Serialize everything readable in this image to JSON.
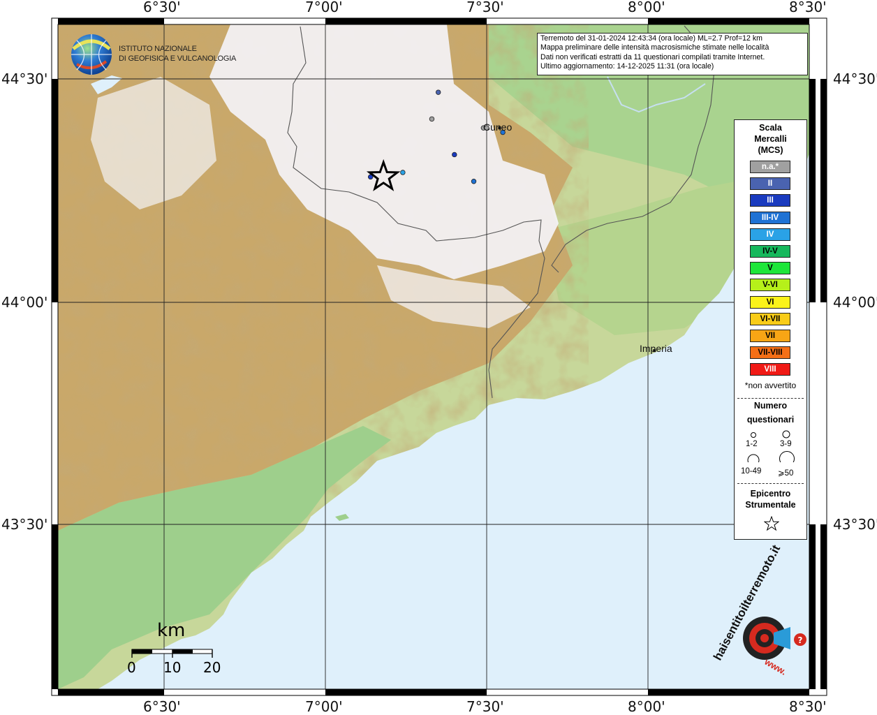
{
  "map": {
    "top_lon_labels": [
      "6°30'",
      "7°00'",
      "7°30'",
      "8°00'",
      "8°30'"
    ],
    "bottom_lon_labels": [
      "6°30'",
      "7°00'",
      "7°30'",
      "8°00'",
      "8°30'"
    ],
    "left_lat_labels": [
      "44°30'",
      "44°00'",
      "43°30'"
    ],
    "right_lat_labels": [
      "44°30'",
      "44°00'",
      "43°30'"
    ],
    "cities": [
      {
        "name": "Cuneo",
        "lon": 7.54,
        "lat": 44.39
      },
      {
        "name": "Imperia",
        "lon": 8.02,
        "lat": 43.89
      }
    ],
    "epicenter": {
      "lon": 7.18,
      "lat": 44.28
    },
    "observations": [
      {
        "lon": 7.35,
        "lat": 44.47,
        "intensity": "II"
      },
      {
        "lon": 7.33,
        "lat": 44.41,
        "intensity": "n.a.*"
      },
      {
        "lon": 7.4,
        "lat": 44.33,
        "intensity": "III"
      },
      {
        "lon": 7.14,
        "lat": 44.28,
        "intensity": "III"
      },
      {
        "lon": 7.24,
        "lat": 44.29,
        "intensity": "IV"
      },
      {
        "lon": 7.46,
        "lat": 44.27,
        "intensity": "III-IV"
      },
      {
        "lon": 7.49,
        "lat": 44.39,
        "intensity": "n.a.*"
      },
      {
        "lon": 7.5,
        "lat": 44.39,
        "intensity": "n.a.*"
      },
      {
        "lon": 7.55,
        "lat": 44.38,
        "intensity": "III-IV"
      }
    ]
  },
  "institute": {
    "line1": "ISTITUTO NAZIONALE",
    "line2": "DI GEOFISICA E VULCANOLOGIA"
  },
  "info": {
    "line1": "Terremoto del 31-01-2024 12:43:34 (ora locale) ML=2.7 Prof=12 km",
    "line2": "Mappa preliminare delle intensità macrosismiche stimate nelle località",
    "line3": "Dati non verificati estratti da 11 questionari compilati tramite Internet.",
    "line4": "Ultimo aggiornamento: 14-12-2025 11:31 (ora locale)"
  },
  "legend": {
    "title_line1": "Scala",
    "title_line2": "Mercalli",
    "title_line3": "(MCS)",
    "scale": [
      {
        "label": "n.a.*",
        "color": "#a0a0a0",
        "text_color": "#ffffff"
      },
      {
        "label": "II",
        "color": "#4a63b0",
        "text_color": "#ffffff"
      },
      {
        "label": "III",
        "color": "#1a3bbf",
        "text_color": "#ffffff"
      },
      {
        "label": "III-IV",
        "color": "#1f72d4",
        "text_color": "#ffffff"
      },
      {
        "label": "IV",
        "color": "#2aa2e6",
        "text_color": "#ffffff"
      },
      {
        "label": "IV-V",
        "color": "#16b85c",
        "text_color": "#000000"
      },
      {
        "label": "V",
        "color": "#1ee63a",
        "text_color": "#000000"
      },
      {
        "label": "V-VI",
        "color": "#b6f01a",
        "text_color": "#000000"
      },
      {
        "label": "VI",
        "color": "#fbf31a",
        "text_color": "#000000"
      },
      {
        "label": "VI-VII",
        "color": "#f9cc18",
        "text_color": "#000000"
      },
      {
        "label": "VII",
        "color": "#f8a515",
        "text_color": "#000000"
      },
      {
        "label": "VII-VIII",
        "color": "#f56f16",
        "text_color": "#000000"
      },
      {
        "label": "VIII",
        "color": "#f01a16",
        "text_color": "#ffffff"
      }
    ],
    "note": "*non avvertito",
    "count_title_line1": "Numero",
    "count_title_line2": "questionari",
    "count_ranges": [
      "1-2",
      "3-9",
      "10-49",
      "⩾50"
    ],
    "epicenter_line1": "Epicentro",
    "epicenter_line2": "Strumentale"
  },
  "scale_bar": {
    "unit": "km",
    "ticks": [
      "0",
      "10",
      "20"
    ]
  },
  "colors": {
    "sea": "#dff0fb",
    "lowland": "#a8d49a",
    "hill": "#dcd9a0",
    "mountain": "#b88a4e",
    "snow": "#f5f4f8",
    "frame": "#000000"
  },
  "brand": {
    "text": "haisentitoilterremoto.it",
    "www": "www."
  }
}
